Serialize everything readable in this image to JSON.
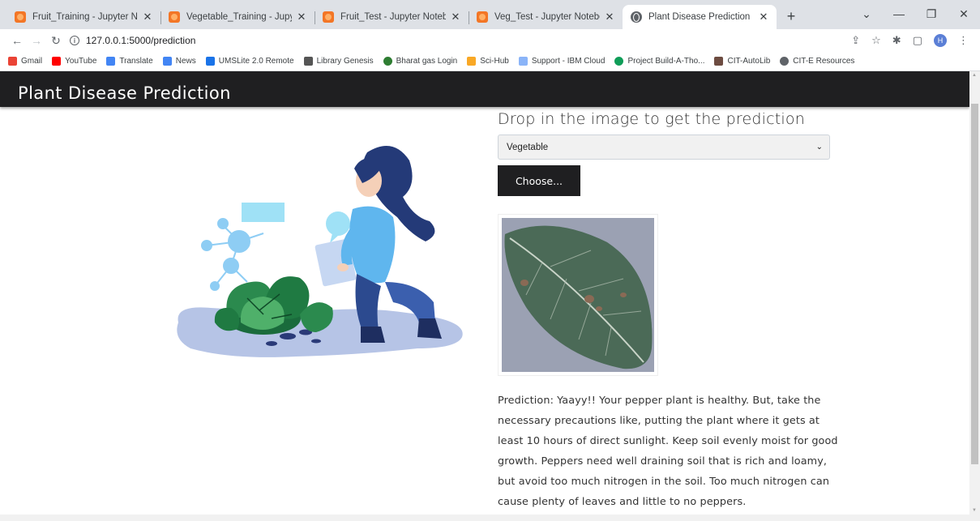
{
  "tabs": [
    {
      "title": "Fruit_Training - Jupyter Notebook",
      "favicon": "jupyter-icon",
      "active": false
    },
    {
      "title": "Vegetable_Training - Jupyter Notebook",
      "favicon": "jupyter-icon",
      "active": false
    },
    {
      "title": "Fruit_Test - Jupyter Notebook",
      "favicon": "jupyter-icon",
      "active": false
    },
    {
      "title": "Veg_Test - Jupyter Notebook",
      "favicon": "jupyter-icon",
      "active": false
    },
    {
      "title": "Plant Disease Prediction",
      "favicon": "globe-icon",
      "active": true
    }
  ],
  "toolbar": {
    "url": "127.0.0.1:5000/prediction",
    "profile_initial": "H"
  },
  "bookmarks": [
    {
      "label": "Gmail",
      "color": "#ea4335"
    },
    {
      "label": "YouTube",
      "color": "#ff0000"
    },
    {
      "label": "Translate",
      "color": "#4285f4"
    },
    {
      "label": "News",
      "color": "#4285f4"
    },
    {
      "label": "UMSLite 2.0 Remote",
      "color": "#1a73e8"
    },
    {
      "label": "Library Genesis",
      "color": "#555555"
    },
    {
      "label": "Bharat gas Login",
      "color": "#2e7d32"
    },
    {
      "label": "Sci-Hub",
      "color": "#f9a825"
    },
    {
      "label": "Support - IBM Cloud",
      "color": "#8ab4f8"
    },
    {
      "label": "Project Build-A-Tho...",
      "color": "#0f9d58"
    },
    {
      "label": "CIT-AutoLib",
      "color": "#6d4c41"
    },
    {
      "label": "CIT-E Resources",
      "color": "#5f6368"
    }
  ],
  "page": {
    "header_title": "Plant Disease Prediction",
    "drop_heading": "Drop in the image to get the prediction",
    "select_value": "Vegetable",
    "choose_label": "Choose...",
    "prediction_text": "Prediction: Yaayy!! Your pepper plant is healthy. But, take the necessary precautions like, putting the plant where it gets at least 10 hours of direct sunlight. Keep soil evenly moist for good growth. Peppers need well draining soil that is rich and loamy, but avoid too much nitrogen in the soil. Too much nitrogen can cause plenty of leaves and little to no peppers."
  },
  "colors": {
    "header_bg": "#1f1f21",
    "button_bg": "#1f1f21",
    "select_bg": "#f1f1f1"
  }
}
